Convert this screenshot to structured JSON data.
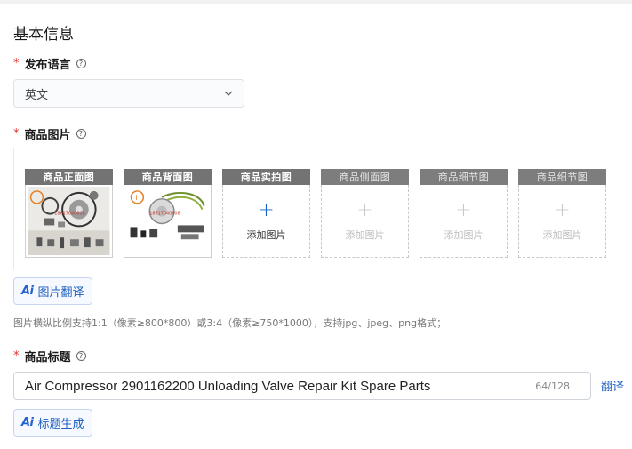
{
  "section": {
    "title": "基本信息"
  },
  "language": {
    "label": "发布语言",
    "required_mark": "*",
    "help_glyph": "?",
    "selected": "英文"
  },
  "images": {
    "label": "商品图片",
    "required_mark": "*",
    "help_glyph": "?",
    "slots": [
      {
        "title": "商品正面图",
        "state": "filled",
        "thumb_icon": "product-photo-front"
      },
      {
        "title": "商品背面图",
        "state": "filled",
        "thumb_icon": "product-photo-back"
      },
      {
        "title": "商品实拍图",
        "state": "empty",
        "plus": "+",
        "add_text": "添加图片"
      },
      {
        "title": "商品侧面图",
        "state": "disabled",
        "plus": "+",
        "add_text": "添加图片"
      },
      {
        "title": "商品细节图",
        "state": "disabled",
        "plus": "+",
        "add_text": "添加图片"
      },
      {
        "title": "商品细节图",
        "state": "disabled",
        "plus": "+",
        "add_text": "添加图片"
      }
    ],
    "translate_button": {
      "ai_mark": "Ai",
      "label": "图片翻译"
    },
    "hint": "图片横纵比例支持1:1（像素≥800*800）或3:4（像素≥750*1000），支持jpg、jpeg、png格式；"
  },
  "product_title": {
    "label": "商品标题",
    "required_mark": "*",
    "help_glyph": "?",
    "value": "Air Compressor 2901162200 Unloading Valve Repair Kit Spare Parts",
    "counter": "64/128",
    "translate_link": "翻译",
    "generate_button": {
      "ai_mark": "Ai",
      "label": "标题生成"
    }
  },
  "colors": {
    "accent": "#1f5fc0",
    "required": "#e0322f",
    "slot_header": "#737373"
  }
}
